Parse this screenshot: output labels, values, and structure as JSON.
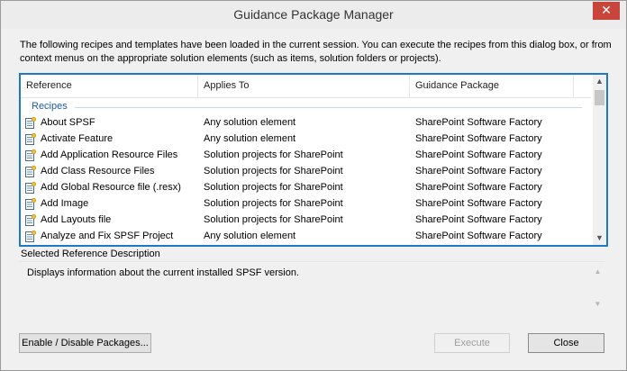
{
  "window": {
    "title": "Guidance Package Manager",
    "close_glyph": "✕"
  },
  "intro_text": "The following recipes and templates have been loaded in the current session. You can execute the recipes from this dialog box, or from context menus on the appropriate solution elements (such as items, solution folders or projects).",
  "list": {
    "columns": [
      "Reference",
      "Applies To",
      "Guidance Package"
    ],
    "group": "Recipes",
    "row_icon": "recipe-icon",
    "rows": [
      {
        "reference": "About SPSF",
        "applies_to": "Any solution element",
        "package": "SharePoint Software Factory"
      },
      {
        "reference": "Activate Feature",
        "applies_to": "Any solution element",
        "package": "SharePoint Software Factory"
      },
      {
        "reference": "Add Application Resource Files",
        "applies_to": "Solution projects for SharePoint",
        "package": "SharePoint Software Factory"
      },
      {
        "reference": "Add Class Resource Files",
        "applies_to": "Solution projects for SharePoint",
        "package": "SharePoint Software Factory"
      },
      {
        "reference": "Add Global Resource file (.resx)",
        "applies_to": "Solution projects for SharePoint",
        "package": "SharePoint Software Factory"
      },
      {
        "reference": "Add Image",
        "applies_to": "Solution projects for SharePoint",
        "package": "SharePoint Software Factory"
      },
      {
        "reference": "Add Layouts file",
        "applies_to": "Solution projects for SharePoint",
        "package": "SharePoint Software Factory"
      },
      {
        "reference": "Analyze and Fix SPSF Project",
        "applies_to": "Any solution element",
        "package": "SharePoint Software Factory"
      }
    ]
  },
  "description": {
    "label": "Selected Reference Description",
    "text": "Displays information about the current installed SPSF version."
  },
  "buttons": {
    "enable_disable": "Enable / Disable Packages...",
    "execute": "Execute",
    "close": "Close"
  },
  "colors": {
    "accent": "#1e78c8",
    "group_label": "#1d5fa5",
    "close_button": "#c7453a"
  }
}
